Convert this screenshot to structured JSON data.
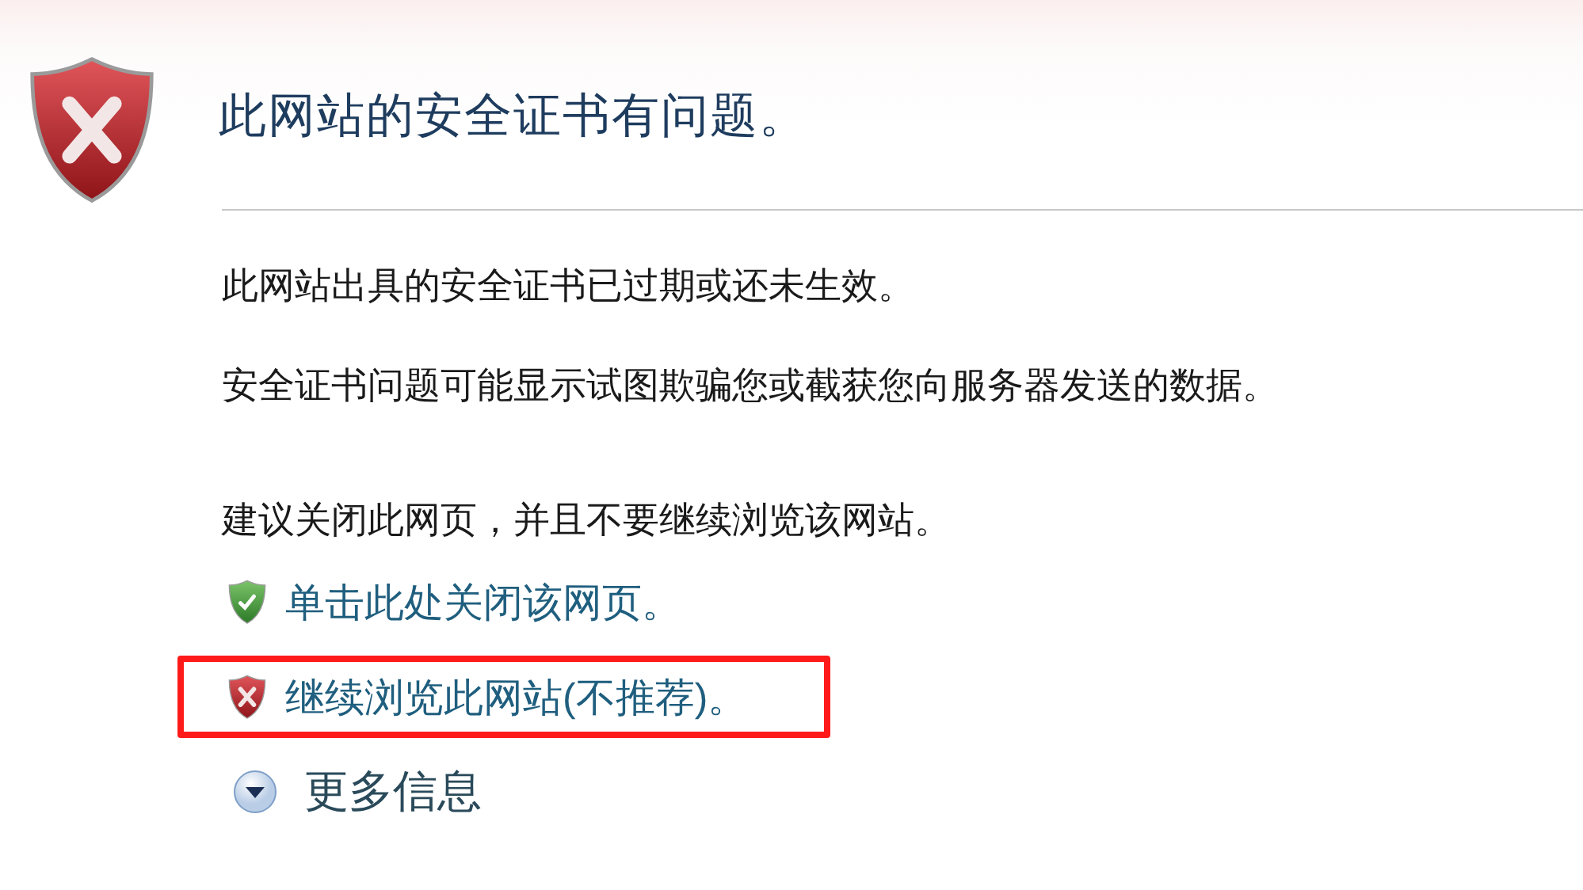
{
  "title": "此网站的安全证书有问题。",
  "paragraphs": [
    "此网站出具的安全证书已过期或还未生效。",
    "安全证书问题可能显示试图欺骗您或截获您向服务器发送的数据。",
    "建议关闭此网页，并且不要继续浏览该网站。"
  ],
  "links": [
    {
      "kind": "safe",
      "label": "单击此处关闭该网页。",
      "highlighted": false
    },
    {
      "kind": "unsafe",
      "label": "继续浏览此网站(不推荐)。",
      "highlighted": true
    }
  ],
  "more_info": {
    "label": "更多信息",
    "expanded": false
  }
}
